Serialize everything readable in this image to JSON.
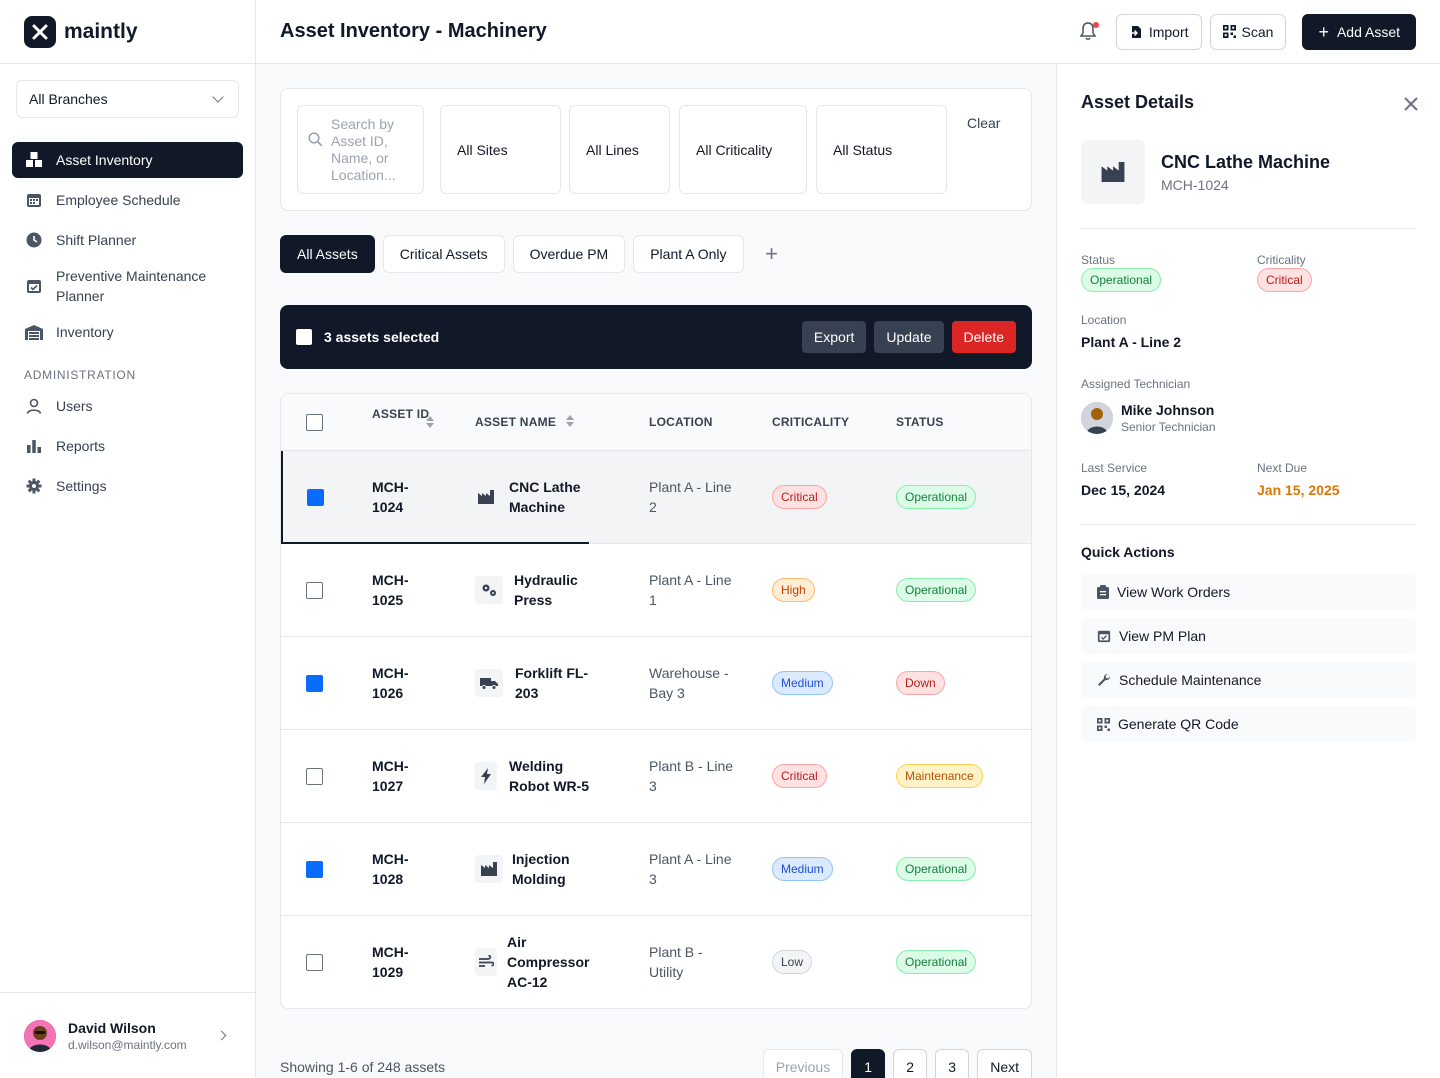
{
  "app": {
    "name": "maintly"
  },
  "sidebar": {
    "branch_select": "All Branches",
    "items": [
      {
        "label": "Asset Inventory",
        "icon": "boxes-icon"
      },
      {
        "label": "Employee Schedule",
        "icon": "calendar-icon"
      },
      {
        "label": "Shift Planner",
        "icon": "clock-icon"
      },
      {
        "label": "Preventive Maintenance Planner",
        "icon": "calendar-check-icon"
      },
      {
        "label": "Inventory",
        "icon": "warehouse-icon"
      }
    ],
    "admin_section": "ADMINISTRATION",
    "admin_items": [
      {
        "label": "Users",
        "icon": "user-icon"
      },
      {
        "label": "Reports",
        "icon": "bar-chart-icon"
      },
      {
        "label": "Settings",
        "icon": "gear-icon"
      }
    ],
    "user": {
      "name": "David Wilson",
      "email": "d.wilson@maintly.com"
    }
  },
  "header": {
    "title": "Asset Inventory - Machinery",
    "import_label": "Import",
    "scan_label": "Scan",
    "add_label": "Add Asset"
  },
  "filters": {
    "search_placeholder": "Search by Asset ID, Name, or Location...",
    "sites": "All Sites",
    "lines": "All Lines",
    "criticality": "All Criticality",
    "status": "All Status",
    "clear": "Clear"
  },
  "view_tabs": [
    "All Assets",
    "Critical Assets",
    "Overdue PM",
    "Plant A Only"
  ],
  "bulk": {
    "text": "3 assets selected",
    "export": "Export",
    "update": "Update",
    "delete": "Delete"
  },
  "table": {
    "columns": [
      "ASSET ID",
      "ASSET NAME",
      "LOCATION",
      "CRITICALITY",
      "STATUS"
    ],
    "rows": [
      {
        "id": "MCH-1024",
        "name": "CNC Lathe Machine",
        "location": "Plant A - Line 2",
        "criticality": "Critical",
        "status": "Operational",
        "checked": true,
        "icon": "factory-icon"
      },
      {
        "id": "MCH-1025",
        "name": "Hydraulic Press",
        "location": "Plant A - Line 1",
        "criticality": "High",
        "status": "Operational",
        "checked": false,
        "icon": "gears-icon"
      },
      {
        "id": "MCH-1026",
        "name": "Forklift FL-203",
        "location": "Warehouse - Bay 3",
        "criticality": "Medium",
        "status": "Down",
        "checked": true,
        "icon": "truck-icon"
      },
      {
        "id": "MCH-1027",
        "name": "Welding Robot WR-5",
        "location": "Plant B - Line 3",
        "criticality": "Critical",
        "status": "Maintenance",
        "checked": false,
        "icon": "bolt-icon"
      },
      {
        "id": "MCH-1028",
        "name": "Injection Molding",
        "location": "Plant A - Line 3",
        "criticality": "Medium",
        "status": "Operational",
        "checked": true,
        "icon": "factory-icon"
      },
      {
        "id": "MCH-1029",
        "name": "Air Compressor AC-12",
        "location": "Plant B - Utility",
        "criticality": "Low",
        "status": "Operational",
        "checked": false,
        "icon": "wind-icon"
      }
    ]
  },
  "pagination": {
    "info": "Showing 1-6 of 248 assets",
    "previous": "Previous",
    "pages": [
      "1",
      "2",
      "3"
    ],
    "next": "Next"
  },
  "detail": {
    "title": "Asset Details",
    "name": "CNC Lathe Machine",
    "id": "MCH-1024",
    "status_label": "Status",
    "status": "Operational",
    "criticality_label": "Criticality",
    "criticality": "Critical",
    "location_label": "Location",
    "location": "Plant A - Line 2",
    "technician_label": "Assigned Technician",
    "technician_name": "Mike Johnson",
    "technician_role": "Senior Technician",
    "last_service_label": "Last Service",
    "last_service": "Dec 15, 2024",
    "next_due_label": "Next Due",
    "next_due": "Jan 15, 2025",
    "next_due_color": "#d97706",
    "quick_actions_title": "Quick Actions",
    "quick_actions": [
      "View Work Orders",
      "View PM Plan",
      "Schedule Maintenance",
      "Generate QR Code"
    ]
  }
}
